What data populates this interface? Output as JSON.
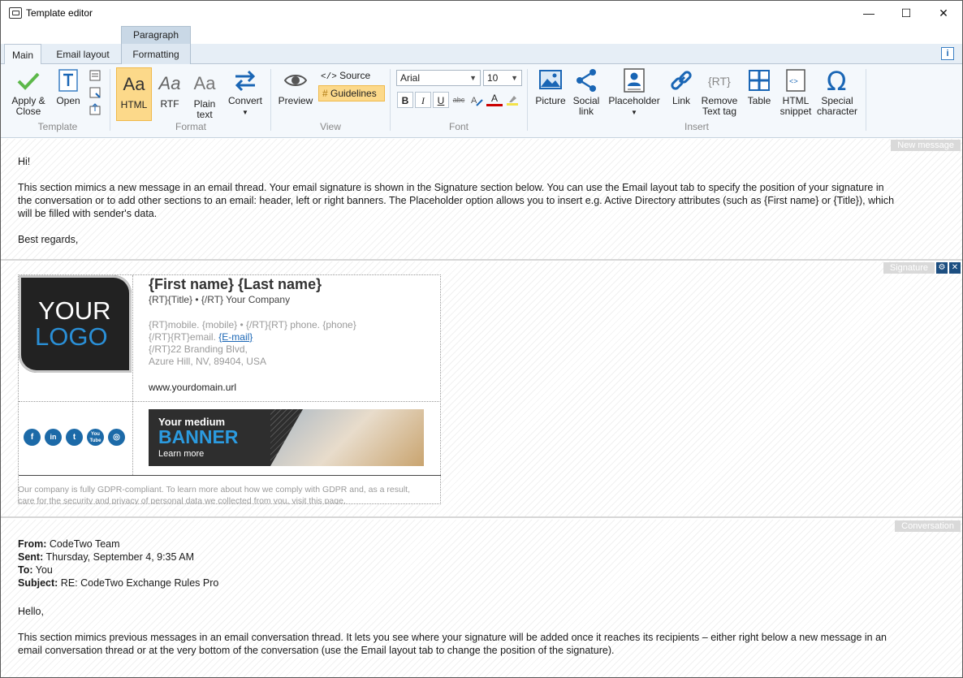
{
  "window": {
    "title": "Template editor",
    "minimize": "—",
    "maximize": "☐",
    "close": "✕"
  },
  "ribbon": {
    "context_tab": "Paragraph",
    "tabs": [
      "Main",
      "Email layout",
      "Formatting"
    ],
    "info": "i",
    "groups": {
      "template": {
        "label": "Template",
        "apply": "Apply &",
        "apply2": "Close",
        "open": "Open"
      },
      "format": {
        "label": "Format",
        "html": "HTML",
        "rtf": "RTF",
        "plain": "Plain",
        "plain2": "text",
        "convert": "Convert",
        "aa": "Aa"
      },
      "view": {
        "label": "View",
        "preview": "Preview",
        "source": "Source",
        "guidelines": "Guidelines"
      },
      "font": {
        "label": "Font",
        "family": "Arial",
        "size": "10",
        "bold": "B",
        "italic": "I",
        "underline": "U",
        "strike": "abc",
        "color": "A"
      },
      "insert": {
        "label": "Insert",
        "picture": "Picture",
        "social": "Social",
        "social2": "link",
        "placeholder": "Placeholder",
        "link": "Link",
        "remove": "Remove",
        "remove2": "Text tag",
        "table": "Table",
        "html": "HTML",
        "html2": "snippet",
        "special": "Special",
        "special2": "character"
      }
    }
  },
  "new_message": {
    "label": "New message",
    "greeting": "Hi!",
    "body_l1": "This section mimics a new message in an email thread. Your email signature is shown in the Signature section below. You can use the Email layout tab to specify the position of your signature in",
    "body_l2": "the conversation or to add other sections to an email: header, left or right banners. The Placeholder option allows you to insert e.g. Active Directory attributes (such as {First name} or {Title}), which",
    "body_l3": "will be filled with sender's data.",
    "closing": "Best regards,"
  },
  "signature": {
    "label": "Signature",
    "logo_l1": "YOUR",
    "logo_l2": "LOGO",
    "name": "{First name} {Last name}",
    "title_line": "{RT}{Title} • {/RT} Your Company",
    "phone_line": "{RT}mobile. {mobile} • {/RT}{RT} phone. {phone}",
    "email_prefix": "{/RT}{RT}email. ",
    "email_link": "{E-mail}",
    "addr1": "{/RT}22 Branding Blvd,",
    "addr2": "Azure Hill, NV, 89404, USA",
    "web": "www.yourdomain.url",
    "social": [
      "f",
      "in",
      "t",
      "You Tube",
      "◎"
    ],
    "banner": {
      "t1": "Your medium",
      "t2": "BANNER",
      "t3": "Learn more"
    },
    "gdpr1": "Our company is fully GDPR-compliant. To learn more about how we comply with GDPR and, as a result,",
    "gdpr2": "care for the security and privacy of personal data we collected from you, visit this page."
  },
  "conversation": {
    "label": "Conversation",
    "from_label": "From:",
    "from": " CodeTwo Team",
    "sent_label": "Sent:",
    "sent": " Thursday, September 4, 9:35 AM",
    "to_label": "To:",
    "to": " You",
    "subject_label": "Subject:",
    "subject": " RE: CodeTwo Exchange Rules Pro",
    "hello": "Hello,",
    "body_l1": "This section mimics previous messages in an email conversation thread. It lets you see where your signature will be added once it reaches its recipients – either right below a new message in an",
    "body_l2": "email conversation thread or at the very bottom of the conversation (use the Email layout tab to change the position of the signature)."
  }
}
